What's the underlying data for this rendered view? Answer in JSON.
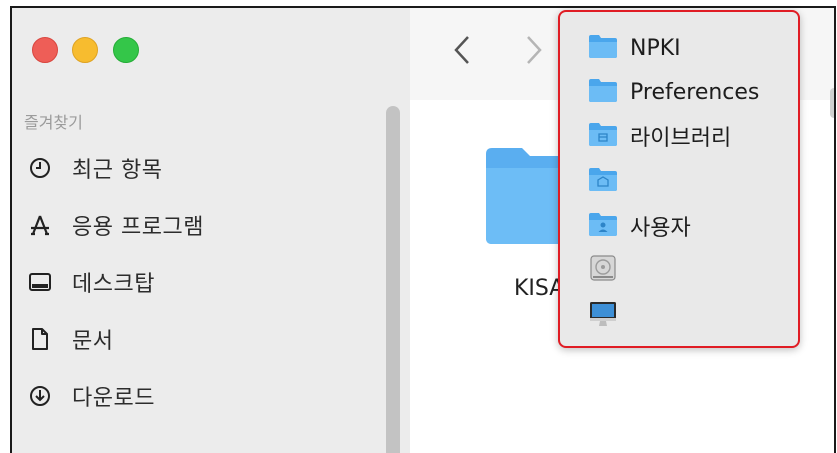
{
  "sidebar": {
    "section_title": "즐겨찾기",
    "items": [
      {
        "label": "최근 항목",
        "icon": "clock-icon"
      },
      {
        "label": "응용 프로그램",
        "icon": "applications-icon"
      },
      {
        "label": "데스크탑",
        "icon": "desktop-icon"
      },
      {
        "label": "문서",
        "icon": "document-icon"
      },
      {
        "label": "다운로드",
        "icon": "download-icon"
      }
    ]
  },
  "content": {
    "folder_name": "KISA"
  },
  "popup": {
    "items": [
      {
        "label": "NPKI",
        "icon": "folder-icon"
      },
      {
        "label": "Preferences",
        "icon": "folder-icon"
      },
      {
        "label": "라이브러리",
        "icon": "library-folder-icon"
      },
      {
        "label": "",
        "icon": "system-folder-icon"
      },
      {
        "label": "사용자",
        "icon": "users-folder-icon"
      },
      {
        "label": "",
        "icon": "hard-disk-icon"
      },
      {
        "label": "",
        "icon": "computer-icon"
      }
    ]
  },
  "colors": {
    "highlight_border": "#e01c24",
    "folder_blue": "#5fb4f4",
    "sidebar_bg": "#ececec"
  }
}
